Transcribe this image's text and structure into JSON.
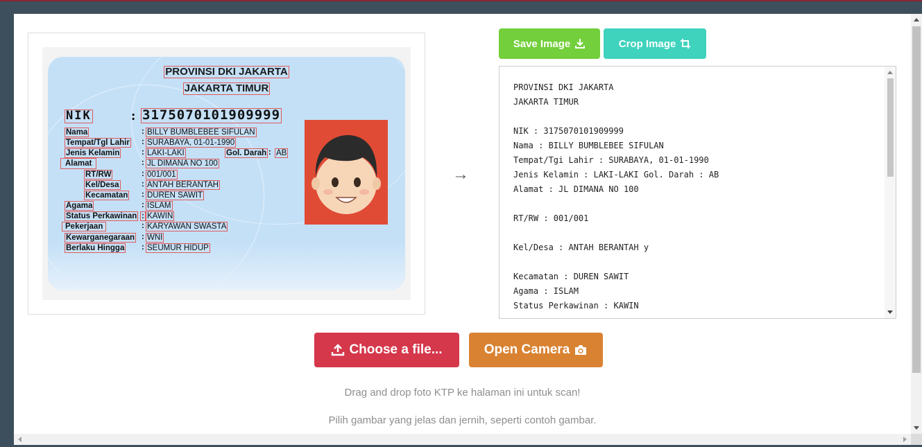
{
  "ktp": {
    "province": "PROVINSI DKI JAKARTA",
    "city": "JAKARTA TIMUR",
    "nik_label": "NIK",
    "nik_value": "3175070101909999",
    "fields": [
      {
        "label": "Nama",
        "value": "BILLY BUMBLEBEE SIFULAN"
      },
      {
        "label": "Tempat/Tgl Lahir",
        "value": "SURABAYA, 01-01-1990"
      },
      {
        "label": "Jenis Kelamin",
        "value": "LAKI-LAKI"
      },
      {
        "label": "Alamat",
        "value": "JL DIMANA NO 100"
      },
      {
        "label": "RT/RW",
        "value": "001/001"
      },
      {
        "label": "Kel/Desa",
        "value": "ANTAH BERANTAH"
      },
      {
        "label": "Kecamatan",
        "value": "DUREN SAWIT"
      },
      {
        "label": "Agama",
        "value": "ISLAM"
      },
      {
        "label": "Status Perkawinan",
        "value": "KAWIN"
      },
      {
        "label": "Pekerjaan",
        "value": "KARYAWAN SWASTA"
      },
      {
        "label": "Kewarganegaraan",
        "value": "WNI"
      },
      {
        "label": "Berlaku Hingga",
        "value": "SEUMUR HIDUP"
      }
    ],
    "blood_label": "Gol. Darah",
    "blood_value": "AB"
  },
  "flow_arrow": "→",
  "toolbar": {
    "save_label": "Save Image",
    "crop_label": "Crop Image"
  },
  "ocr_result": "PROVINSI DKI JAKARTA\nJAKARTA TIMUR\n\nNIK : 3175070101909999\nNama : BILLY BUMBLEBEE SIFULAN\nTempat/Tgi Lahir : SURABAYA, 01-01-1990\nJenis Kelamin : LAKI-LAKI Gol. Darah : AB\nAlamat : JL DIMANA NO 100\n\nRT/RW : 001/001\n\nKel/Desa : ANTAH BERANTAH y\n\nKecamatan : DUREN SAWIT\nAgama : ISLAM\nStatus Perkawinan : KAWIN",
  "actions": {
    "choose_file_label": "Choose a file...",
    "open_camera_label": "Open Camera"
  },
  "hints": {
    "drag_drop": "Drag and drop foto KTP ke halaman ini untuk scan!",
    "clear_image": "Pilih gambar yang jelas dan jernih, seperti contoh gambar."
  },
  "icons": {
    "save": "download-icon",
    "crop": "crop-icon",
    "upload": "upload-icon",
    "camera": "camera-icon"
  },
  "colors": {
    "save": "#73cf3b",
    "crop": "#3fd3be",
    "choose_file": "#d5374b",
    "open_camera": "#d98231",
    "photo_bg": "#e04b35",
    "card_bg": "#c4e0f7"
  }
}
